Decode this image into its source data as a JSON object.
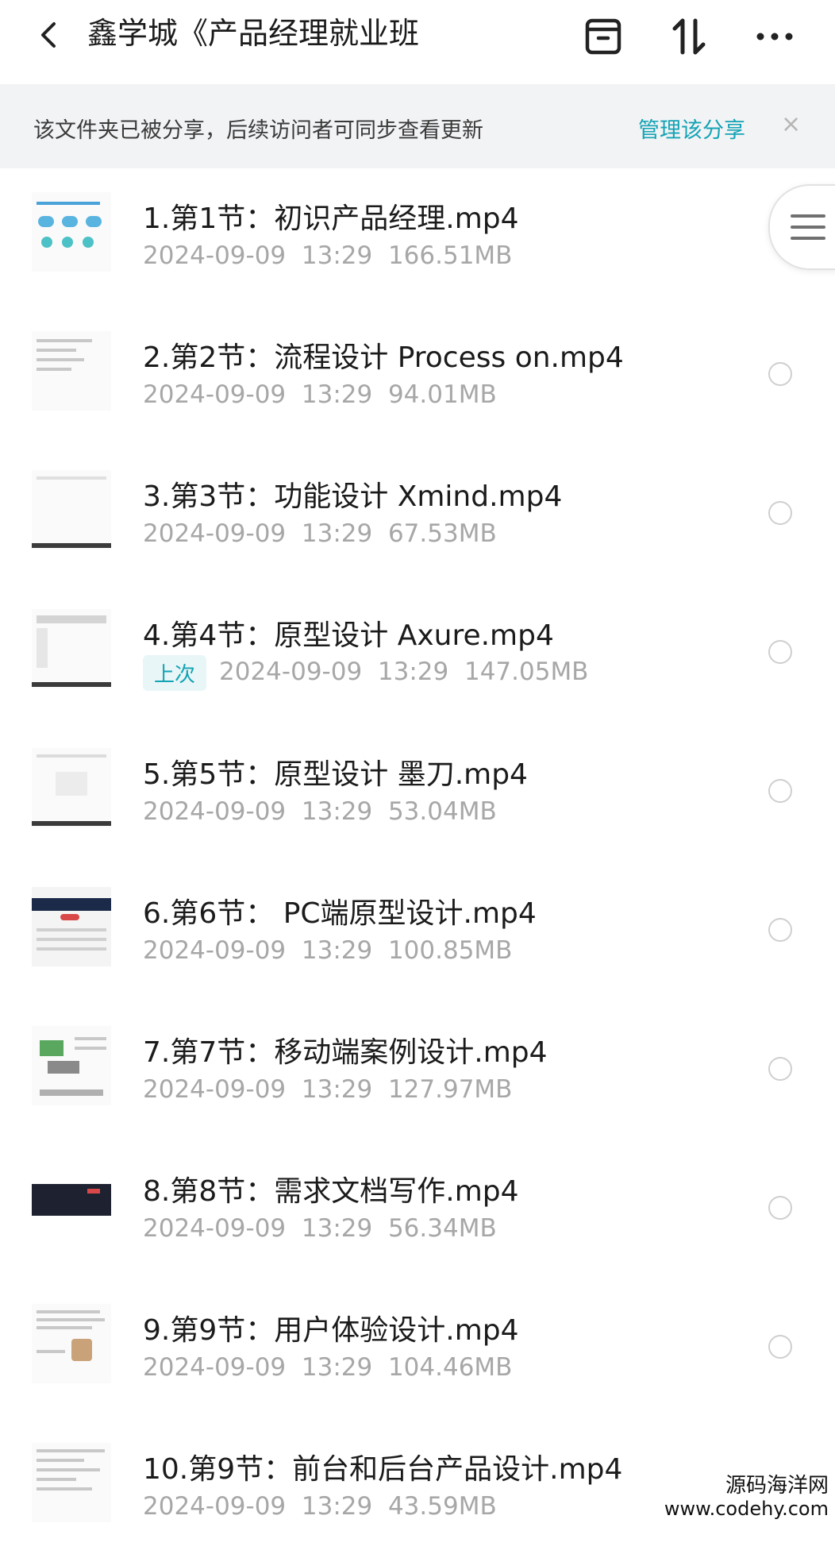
{
  "header": {
    "title": "鑫学城《产品经理就业班",
    "back_icon": "chevron-left-icon",
    "archive_icon": "box-icon",
    "sort_icon": "sort-arrows-icon",
    "more_icon": "more-horizontal-icon"
  },
  "banner": {
    "text": "该文件夹已被分享，后续访问者可同步查看更新",
    "link": "管理该分享",
    "close": "×"
  },
  "files": [
    {
      "name": "1.第1节：初识产品经理.mp4",
      "date": "2024-09-09",
      "time": "13:29",
      "size": "166.51MB",
      "tag": ""
    },
    {
      "name": "2.第2节：流程设计 Process on.mp4",
      "date": "2024-09-09",
      "time": "13:29",
      "size": "94.01MB",
      "tag": ""
    },
    {
      "name": "3.第3节：功能设计 Xmind.mp4",
      "date": "2024-09-09",
      "time": "13:29",
      "size": "67.53MB",
      "tag": ""
    },
    {
      "name": "4.第4节：原型设计 Axure.mp4",
      "date": "2024-09-09",
      "time": "13:29",
      "size": "147.05MB",
      "tag": "上次"
    },
    {
      "name": "5.第5节：原型设计 墨刀.mp4",
      "date": "2024-09-09",
      "time": "13:29",
      "size": "53.04MB",
      "tag": ""
    },
    {
      "name": "6.第6节： PC端原型设计.mp4",
      "date": "2024-09-09",
      "time": "13:29",
      "size": "100.85MB",
      "tag": ""
    },
    {
      "name": "7.第7节：移动端案例设计.mp4",
      "date": "2024-09-09",
      "time": "13:29",
      "size": "127.97MB",
      "tag": ""
    },
    {
      "name": "8.第8节：需求文档写作.mp4",
      "date": "2024-09-09",
      "time": "13:29",
      "size": "56.34MB",
      "tag": ""
    },
    {
      "name": "9.第9节：用户体验设计.mp4",
      "date": "2024-09-09",
      "time": "13:29",
      "size": "104.46MB",
      "tag": ""
    },
    {
      "name": "10.第9节：前台和后台产品设计.mp4",
      "date": "2024-09-09",
      "time": "13:29",
      "size": "43.59MB",
      "tag": ""
    }
  ],
  "watermark": {
    "line1": "源码海洋网",
    "line2": "www.codehy.com"
  },
  "colors": {
    "accent": "#14a3b4",
    "banner_bg": "#f2f3f5",
    "meta_text": "#a7a7a7"
  }
}
